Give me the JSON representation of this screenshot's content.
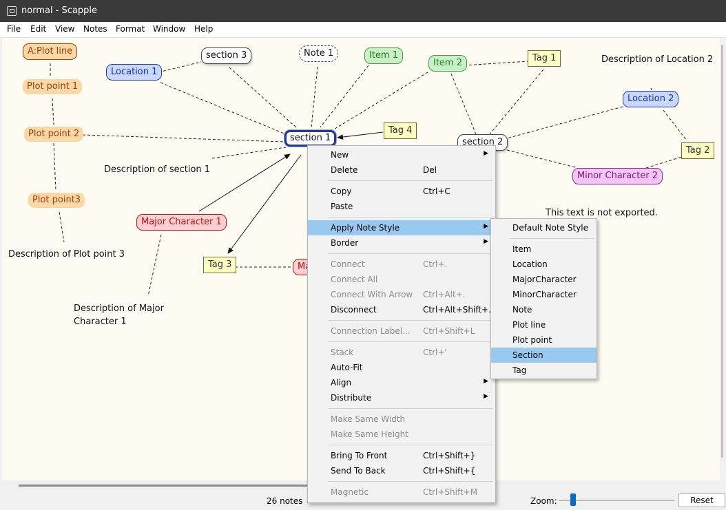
{
  "window": {
    "title": "normal - Scapple"
  },
  "menubar": {
    "items": [
      "File",
      "Edit",
      "View",
      "Notes",
      "Format",
      "Window",
      "Help"
    ]
  },
  "notes": {
    "plot_line": "A:Plot line",
    "plot_point_1": "Plot point 1",
    "plot_point_2": "Plot point 2",
    "plot_point_3": "Plot point3",
    "desc_plot_point_3": "Description of Plot point 3",
    "location_1": "Location 1",
    "section_3": "section 3",
    "note_1": "Note 1",
    "item_1": "Item 1",
    "item_2": "Item 2",
    "tag_1": "Tag 1",
    "desc_location_2": "Description of Location 2",
    "location_2": "Location 2",
    "tag_2": "Tag 2",
    "minor_character_2": "Minor Character 2",
    "tag_4": "Tag 4",
    "section_1": "section 1",
    "section_2": "section 2",
    "desc_section_1": "Description of section 1",
    "major_character_1": "Major Character 1",
    "tag_3": "Tag 3",
    "major_partial": "Ma",
    "desc_major_line1": "Description of Major",
    "desc_major_line2": "Character 1",
    "not_exported": "This text is not exported."
  },
  "context_menu": {
    "items": [
      {
        "label": "New",
        "shortcut": "",
        "submenu": true,
        "disabled": false
      },
      {
        "label": "Delete",
        "shortcut": "Del",
        "disabled": false
      },
      {
        "label": "Copy",
        "shortcut": "Ctrl+C",
        "disabled": false
      },
      {
        "label": "Paste",
        "shortcut": "",
        "disabled": false
      },
      {
        "label": "Apply Note Style",
        "shortcut": "",
        "submenu": true,
        "highlighted": true
      },
      {
        "label": "Border",
        "shortcut": "",
        "submenu": true,
        "disabled": false
      },
      {
        "label": "Connect",
        "shortcut": "Ctrl+.",
        "disabled": true
      },
      {
        "label": "Connect All",
        "shortcut": "",
        "disabled": true
      },
      {
        "label": "Connect With Arrow",
        "shortcut": "Ctrl+Alt+.",
        "disabled": true
      },
      {
        "label": "Disconnect",
        "shortcut": "Ctrl+Alt+Shift+.",
        "disabled": false
      },
      {
        "label": "Connection Label...",
        "shortcut": "Ctrl+Shift+L",
        "disabled": true
      },
      {
        "label": "Stack",
        "shortcut": "Ctrl+'",
        "disabled": true
      },
      {
        "label": "Auto-Fit",
        "shortcut": "",
        "disabled": false
      },
      {
        "label": "Align",
        "shortcut": "",
        "submenu": true,
        "disabled": false
      },
      {
        "label": "Distribute",
        "shortcut": "",
        "submenu": true,
        "disabled": false
      },
      {
        "label": "Make Same Width",
        "shortcut": "",
        "disabled": true
      },
      {
        "label": "Make Same Height",
        "shortcut": "",
        "disabled": true
      },
      {
        "label": "Bring To Front",
        "shortcut": "Ctrl+Shift+}",
        "disabled": false
      },
      {
        "label": "Send To Back",
        "shortcut": "Ctrl+Shift+{",
        "disabled": false
      },
      {
        "label": "Magnetic",
        "shortcut": "Ctrl+Shift+M",
        "disabled": true
      }
    ]
  },
  "style_submenu": {
    "items": [
      "Default Note Style",
      "Item",
      "Location",
      "MajorCharacter",
      "MinorCharacter",
      "Note",
      "Plot line",
      "Plot point",
      "Section",
      "Tag"
    ],
    "highlighted": "Section"
  },
  "status": {
    "note_count": "26 notes",
    "zoom_label": "Zoom:",
    "reset_label": "Reset"
  },
  "icons": {
    "submenu_arrow": "chevron-right-icon",
    "app": "scapple-app-icon"
  },
  "colors": {
    "canvas_bg": "#fefcf2",
    "highlight": "#99c9ef",
    "selected_border": "#1f3a9c",
    "titlebar": "#3a3a3a"
  }
}
